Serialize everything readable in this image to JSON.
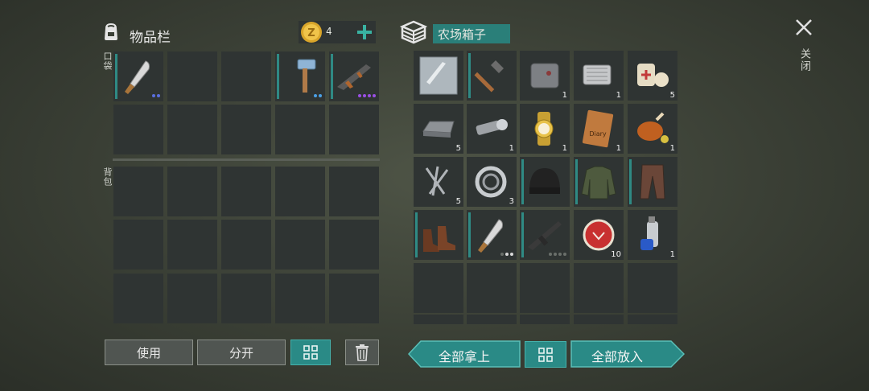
{
  "inventory": {
    "title": "物品栏",
    "icon": "backpack-icon",
    "coins": "4",
    "coin_icon": "gold-coin-icon",
    "add_icon": "plus-icon",
    "pocket_label": "口袋",
    "backpack_label": "背包",
    "pocket_slots": [
      {
        "item": "machete",
        "qty": "",
        "dots": [
          "#5a6fe0",
          "#5a6fe0"
        ],
        "bar": true
      },
      {
        "item": "",
        "qty": ""
      },
      {
        "item": "",
        "qty": ""
      },
      {
        "item": "hammer",
        "qty": "",
        "dots": [
          "#4aa0e6",
          "#4aa0e6"
        ],
        "bar": true
      },
      {
        "item": "rifle-ak",
        "qty": "",
        "dots": [
          "#9a4fe6",
          "#9a4fe6",
          "#9a4fe6",
          "#9a4fe6"
        ],
        "bar": true
      }
    ]
  },
  "box": {
    "title": "农场箱子",
    "icon": "crate-icon",
    "slots": [
      {
        "item": "machete-blueprint",
        "qty": ""
      },
      {
        "item": "shovel",
        "qty": "",
        "bar": true
      },
      {
        "item": "metal-plate",
        "qty": "1"
      },
      {
        "item": "engine-part",
        "qty": "1"
      },
      {
        "item": "bandage",
        "qty": "5"
      },
      {
        "item": "metal-ingot",
        "qty": "5"
      },
      {
        "item": "flashlight",
        "qty": "1"
      },
      {
        "item": "gold-watch",
        "qty": "1"
      },
      {
        "item": "diary-book",
        "qty": "1"
      },
      {
        "item": "roast-chicken",
        "qty": "1"
      },
      {
        "item": "nails",
        "qty": "5"
      },
      {
        "item": "bearing",
        "qty": "3"
      },
      {
        "item": "beanie-hat",
        "qty": "",
        "bar": true
      },
      {
        "item": "jacket",
        "qty": "",
        "bar": true
      },
      {
        "item": "pants",
        "qty": "",
        "bar": true
      },
      {
        "item": "boots",
        "qty": "",
        "bar": true
      },
      {
        "item": "machete",
        "qty": "",
        "bar": true,
        "dots": [
          "#6a6f6a",
          "#d8d8d8",
          "#d8d8d8"
        ]
      },
      {
        "item": "rifle-m4",
        "qty": "",
        "bar": true,
        "dots": [
          "#6a6f6a",
          "#6a6f6a",
          "#6a6f6a",
          "#6a6f6a"
        ]
      },
      {
        "item": "bottle-cap",
        "qty": "10"
      },
      {
        "item": "paint-spray",
        "qty": "1"
      }
    ]
  },
  "actions": {
    "use": "使用",
    "split": "分开",
    "sort_icon": "grid-sort-icon",
    "trash_icon": "trash-icon",
    "take_all": "全部拿上",
    "put_all": "全部放入"
  },
  "close": {
    "icon": "close-icon",
    "label": "关闭"
  }
}
